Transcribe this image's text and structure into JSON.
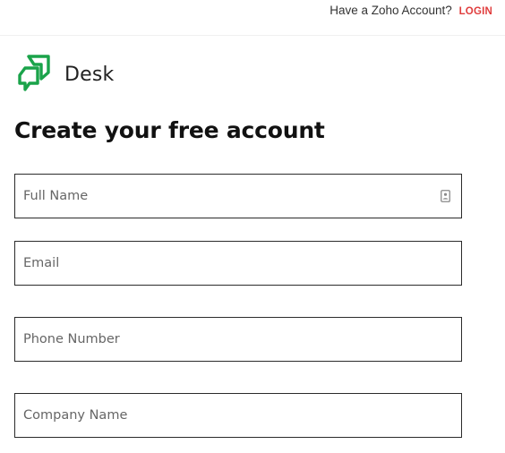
{
  "header": {
    "have_account_text": "Have a Zoho Account?",
    "login_label": "LOGIN"
  },
  "brand": {
    "logo_icon": "zoho-desk-logo-icon",
    "name": "Desk",
    "logo_color": "#1aa34a"
  },
  "form": {
    "heading": "Create your free account",
    "fields": {
      "full_name": {
        "placeholder": "Full Name",
        "value": "",
        "icon": "contact-card-icon"
      },
      "email": {
        "placeholder": "Email",
        "value": ""
      },
      "phone": {
        "placeholder": "Phone Number",
        "value": ""
      },
      "company": {
        "placeholder": "Company Name",
        "value": ""
      }
    }
  },
  "colors": {
    "login_link": "#e03d3d",
    "field_border": "#2b2b2b",
    "heading_text": "#111111"
  }
}
